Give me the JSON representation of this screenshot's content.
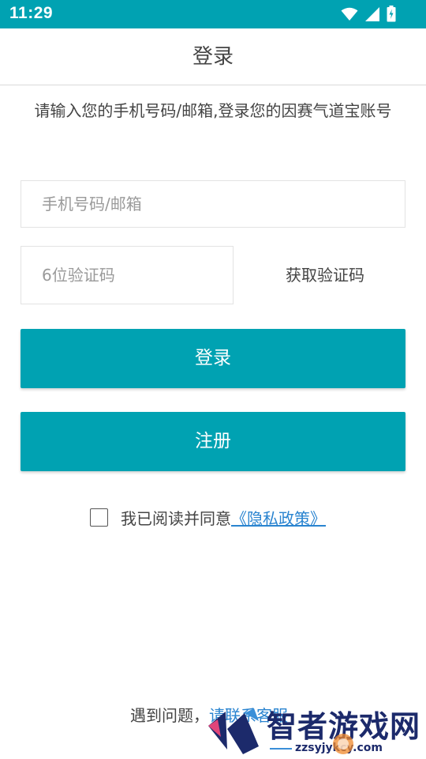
{
  "status_bar": {
    "time": "11:29",
    "icons": [
      "wifi-icon",
      "signal-icon",
      "battery-icon"
    ],
    "color": "#00a2b2"
  },
  "header": {
    "title": "登录"
  },
  "subtitle": "请输入您的手机号码/邮箱,登录您的因赛气道宝账号",
  "form": {
    "account_placeholder": "手机号码/邮箱",
    "code_placeholder": "6位验证码",
    "get_code_label": "获取验证码"
  },
  "buttons": {
    "login_label": "登录",
    "register_label": "注册"
  },
  "agreement": {
    "checked": false,
    "text": "我已阅读并同意",
    "link": "《隐私政策》"
  },
  "help": {
    "text": "遇到问题，",
    "link": "请联系客服"
  },
  "watermark": {
    "name": "智者游戏网",
    "url": "zzsyjykcy.com"
  },
  "colors": {
    "accent": "#00a2b2",
    "link": "#2a84d0"
  }
}
